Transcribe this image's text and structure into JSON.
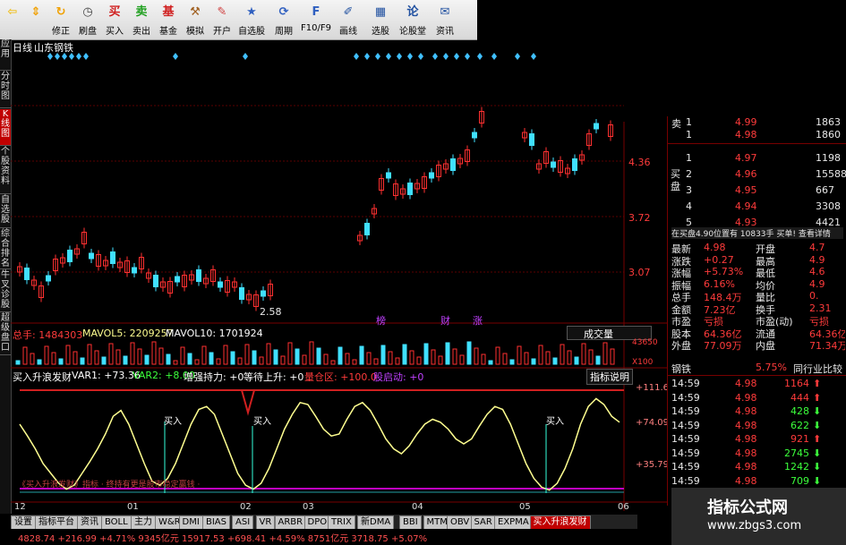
{
  "toolbar": {
    "items": [
      {
        "label": "",
        "icon": "arrow-left-icon"
      },
      {
        "label": "",
        "icon": "arrow-up-down-icon"
      },
      {
        "label": "修正",
        "icon": "refresh-icon"
      },
      {
        "label": "刷盘",
        "icon": "clock-icon"
      },
      {
        "label": "买入",
        "icon": "buy-icon"
      },
      {
        "label": "卖出",
        "icon": "sell-icon"
      },
      {
        "label": "基金",
        "icon": "fund-icon"
      },
      {
        "label": "模拟",
        "icon": "gavel-icon"
      },
      {
        "label": "开户",
        "icon": "lock-icon"
      },
      {
        "label": "自选股",
        "icon": "star-icon"
      },
      {
        "label": "周期",
        "icon": "cycle-icon"
      },
      {
        "label": "F10/F9",
        "icon": "f10-icon"
      },
      {
        "label": "画线",
        "icon": "pen-icon"
      },
      {
        "label": "选股",
        "icon": "select-icon"
      },
      {
        "label": "论股堂",
        "icon": "forum-icon"
      },
      {
        "label": "资讯",
        "icon": "news-icon"
      }
    ]
  },
  "sidebar": {
    "items": [
      {
        "label": "应用"
      },
      {
        "label": "分时图"
      },
      {
        "label": "K线图"
      },
      {
        "label": "个股资料"
      },
      {
        "label": "自选股"
      },
      {
        "label": "综合排名"
      },
      {
        "label": "牛叉诊股"
      },
      {
        "label": "超级盘口"
      }
    ]
  },
  "chart": {
    "period_label": "日线",
    "stock_name": "山东钢铁",
    "price_ticks": [
      "4.36",
      "3.72",
      "3.07"
    ],
    "low_label": "2.58",
    "event_labels": [
      "榜",
      "财",
      "涨"
    ],
    "volume_indicator": {
      "name": "总手",
      "value": "1484303",
      "ma5_label": "MAVOL5:",
      "ma5_value": "2209257",
      "ma10_label": "MAVOL10:",
      "ma10_value": "1701924",
      "selector": "成交量",
      "ticks": [
        "43650",
        "X100"
      ]
    },
    "custom_indicator": {
      "name": "买入升浪发财",
      "var1": "VAR1: +73.36",
      "var2": "VAR2: +8.00",
      "strength": "增强持力: +0",
      "wait": "等待上升: +0",
      "warehouse": "量仓区: +100.0",
      "startup": "股启动: +0",
      "help": "指标说明",
      "ticks": [
        "+111.6",
        "+74.09",
        "+35.79"
      ],
      "buy_label": "买入",
      "footer_text": "《买入升浪发财》指标  · 终持有更是股市稳定赢钱 ·"
    },
    "x_ticks": [
      "12",
      "01",
      "02",
      "03",
      "04",
      "05",
      "06"
    ],
    "line_values": [
      70,
      58,
      45,
      30,
      20,
      10,
      4,
      8,
      20,
      32,
      45,
      60,
      78,
      84,
      70,
      50,
      30,
      12,
      8,
      15,
      30,
      50,
      70,
      85,
      88,
      80,
      60,
      40,
      20,
      8,
      4,
      10,
      25,
      45,
      65,
      80,
      92,
      90,
      78,
      65,
      58,
      60,
      75,
      88,
      92,
      84,
      70,
      55,
      45,
      40,
      48,
      60,
      70,
      75,
      72,
      65,
      55,
      50,
      55,
      68,
      80,
      88,
      85,
      70,
      50,
      30,
      15,
      6,
      3,
      10,
      25,
      45,
      70,
      88,
      96,
      90,
      78,
      72
    ]
  },
  "quote": {
    "sell_rows": [
      {
        "label": "卖",
        "level": "1",
        "price": "4.99",
        "vol": "1863"
      },
      {
        "label": "",
        "level": "1",
        "price": "4.98",
        "vol": "1860"
      }
    ],
    "buy_rows": [
      {
        "level": "1",
        "price": "4.97",
        "vol": "1198"
      },
      {
        "level": "2",
        "price": "4.96",
        "vol": "15588"
      },
      {
        "level": "3",
        "price": "4.95",
        "vol": "667"
      },
      {
        "level": "4",
        "price": "4.94",
        "vol": "3308"
      },
      {
        "level": "5",
        "price": "4.93",
        "vol": "4421"
      }
    ],
    "buy_side_label": "买盘",
    "info_bar": "在买盘4.90位置有   10833手  买单!  查看详情",
    "stats": [
      {
        "k": "最新",
        "v": "4.98",
        "k2": "开盘",
        "v2": "4.7"
      },
      {
        "k": "涨跌",
        "v": "+0.27",
        "k2": "最高",
        "v2": "4.9"
      },
      {
        "k": "涨幅",
        "v": "+5.73%",
        "k2": "最低",
        "v2": "4.6"
      },
      {
        "k": "振幅",
        "v": "6.16%",
        "k2": "均价",
        "v2": "4.9"
      },
      {
        "k": "总手",
        "v": "148.4万",
        "k2": "量比",
        "v2": "0."
      },
      {
        "k": "金额",
        "v": "7.23亿",
        "k2": "换手",
        "v2": "2.31"
      },
      {
        "k": "市盈",
        "v": "亏损",
        "k2": "市盈(动)",
        "v2": "亏损"
      },
      {
        "k": "股本",
        "v": "64.36亿",
        "k2": "流通",
        "v2": "64.36亿"
      },
      {
        "k": "外盘",
        "v": "77.09万",
        "k2": "内盘",
        "v2": "71.34万"
      }
    ],
    "sector_label": "钢铁",
    "sector_change": "5.75%",
    "sector_compare": "同行业比较",
    "ticks": [
      {
        "t": "14:59",
        "p": "4.98",
        "v": "1164",
        "dir": "up"
      },
      {
        "t": "14:59",
        "p": "4.98",
        "v": "444",
        "dir": "up"
      },
      {
        "t": "14:59",
        "p": "4.98",
        "v": "428",
        "dir": "down"
      },
      {
        "t": "14:59",
        "p": "4.98",
        "v": "622",
        "dir": "down"
      },
      {
        "t": "14:59",
        "p": "4.98",
        "v": "921",
        "dir": "up"
      },
      {
        "t": "14:59",
        "p": "4.98",
        "v": "2745",
        "dir": "down"
      },
      {
        "t": "14:59",
        "p": "4.98",
        "v": "1242",
        "dir": "down"
      },
      {
        "t": "14:59",
        "p": "4.98",
        "v": "709",
        "dir": "down"
      }
    ]
  },
  "tabs": [
    "设置",
    "指标平台",
    "资讯",
    "BOLL",
    "主力",
    "W&R",
    "DMI",
    "BIAS",
    "ASI",
    "VR",
    "ARBR",
    "DPO",
    "TRIX",
    "新DMA",
    "BBI",
    "MTM",
    "OBV",
    "SAR",
    "EXPMA",
    "买入升浪发财"
  ],
  "status": {
    "text": "4828.74   +216.99  +4.71%   9345亿元  15917.53  +698.41  +4.59%   8751亿元  3718.75  +5.07%"
  },
  "watermark": {
    "title": "指标公式网",
    "url": "www.zbgs3.com"
  },
  "colors": {
    "up": "#ff3b3b",
    "down": "#3cff3c",
    "bg": "#000000",
    "accent": "#c00000"
  }
}
